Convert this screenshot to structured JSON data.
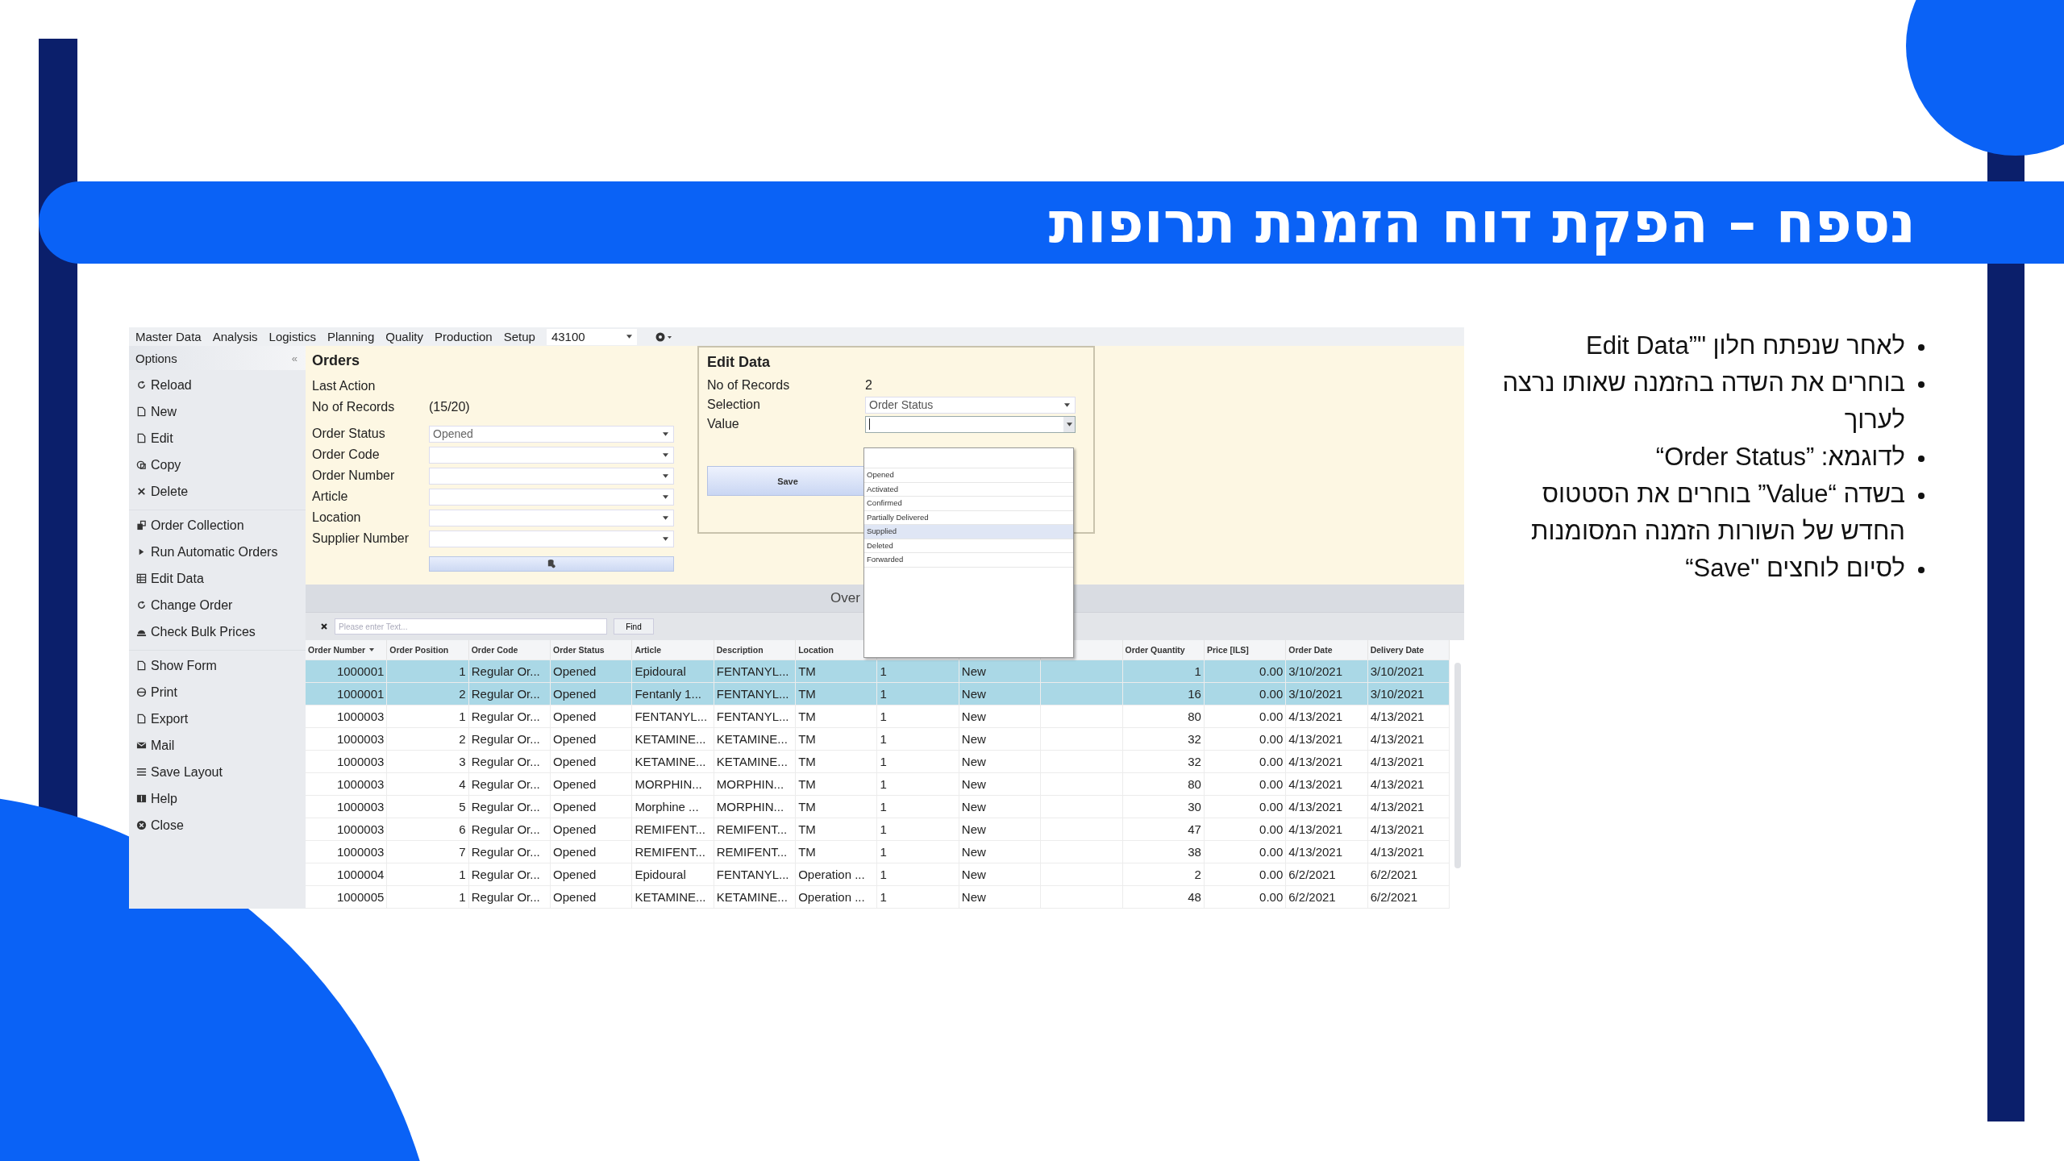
{
  "slide": {
    "title": "נספח – הפקת דוח הזמנת תרופות",
    "bullets": [
      "לאחר שנפתח חלון \"”Edit Data",
      "בוחרים את השדה בהזמנה שאותו נרצה לערוך",
      "לדוגמא: ”Order Status“",
      "בשדה “Value” בוחרים את הסטטוס החדש של השורות הזמנה המסומנות",
      "לסיום לוחצים \"Save“"
    ]
  },
  "app": {
    "menu": [
      "Master Data",
      "Analysis",
      "Logistics",
      "Planning",
      "Quality",
      "Production",
      "Setup"
    ],
    "combo": {
      "value": "43100"
    },
    "sidebar": {
      "title": "Options",
      "collapse": "«",
      "groups": [
        [
          "Reload",
          "New",
          "Edit",
          "Copy",
          "Delete"
        ],
        [
          "Order Collection",
          "Run Automatic Orders",
          "Edit Data",
          "Change Order",
          "Check Bulk Prices"
        ],
        [
          "Show Form",
          "Print",
          "Export",
          "Mail",
          "Save Layout",
          "Help",
          "Close"
        ]
      ]
    },
    "form": {
      "title": "Orders",
      "last_action": {
        "label": "Last Action"
      },
      "records": {
        "label": "No of Records",
        "value": "(15/20)"
      },
      "filters": [
        {
          "label": "Order Status",
          "value": "Opened"
        },
        {
          "label": "Order Code"
        },
        {
          "label": "Order Number"
        },
        {
          "label": "Article"
        },
        {
          "label": "Location"
        },
        {
          "label": "Supplier Number"
        }
      ]
    },
    "edit_dialog": {
      "title": "Edit Data",
      "records": {
        "label": "No of Records",
        "value": "2"
      },
      "selection": {
        "label": "Selection",
        "value": "Order Status"
      },
      "value_field": {
        "label": "Value",
        "expanded": true
      },
      "save": "Save",
      "options": [
        {
          "label": "Opened",
          "selected": false
        },
        {
          "label": "Activated",
          "selected": false
        },
        {
          "label": "Confirmed",
          "selected": false
        },
        {
          "label": "Partially Delivered",
          "selected": false
        },
        {
          "label": "Supplied",
          "selected": true
        },
        {
          "label": "Deleted",
          "selected": false
        },
        {
          "label": "Forwarded",
          "selected": false
        }
      ]
    },
    "overview": {
      "title": "Over",
      "search": {
        "placeholder": "Please enter Text...",
        "button": "Find"
      }
    },
    "table": {
      "columns_left": [
        "Order Number",
        "Order Position",
        "Order Code",
        "Order Status",
        "Article",
        "Description",
        "Location"
      ],
      "columns_right": [
        "Order Quantity",
        "Price [ILS]",
        "Order Date",
        "Delivery Date"
      ],
      "rows": [
        {
          "selected": true,
          "cells": [
            "1000001",
            "1",
            "Regular Or...",
            "Opened",
            "Epidoural",
            "FENTANYL...",
            "TM",
            "1",
            "New",
            "1",
            "0.00",
            "3/10/2021",
            "3/10/2021"
          ]
        },
        {
          "selected": true,
          "cells": [
            "1000001",
            "2",
            "Regular Or...",
            "Opened",
            "Fentanly 1...",
            "FENTANYL...",
            "TM",
            "1",
            "New",
            "16",
            "0.00",
            "3/10/2021",
            "3/10/2021"
          ]
        },
        {
          "selected": false,
          "cells": [
            "1000003",
            "1",
            "Regular Or...",
            "Opened",
            "FENTANYL...",
            "FENTANYL...",
            "TM",
            "1",
            "New",
            "80",
            "0.00",
            "4/13/2021",
            "4/13/2021"
          ]
        },
        {
          "selected": false,
          "cells": [
            "1000003",
            "2",
            "Regular Or...",
            "Opened",
            "KETAMINE...",
            "KETAMINE...",
            "TM",
            "1",
            "New",
            "32",
            "0.00",
            "4/13/2021",
            "4/13/2021"
          ]
        },
        {
          "selected": false,
          "cells": [
            "1000003",
            "3",
            "Regular Or...",
            "Opened",
            "KETAMINE...",
            "KETAMINE...",
            "TM",
            "1",
            "New",
            "32",
            "0.00",
            "4/13/2021",
            "4/13/2021"
          ]
        },
        {
          "selected": false,
          "cells": [
            "1000003",
            "4",
            "Regular Or...",
            "Opened",
            "MORPHIN...",
            "MORPHIN...",
            "TM",
            "1",
            "New",
            "80",
            "0.00",
            "4/13/2021",
            "4/13/2021"
          ]
        },
        {
          "selected": false,
          "cells": [
            "1000003",
            "5",
            "Regular Or...",
            "Opened",
            "Morphine ...",
            "MORPHIN...",
            "TM",
            "1",
            "New",
            "30",
            "0.00",
            "4/13/2021",
            "4/13/2021"
          ]
        },
        {
          "selected": false,
          "cells": [
            "1000003",
            "6",
            "Regular Or...",
            "Opened",
            "REMIFENT...",
            "REMIFENT...",
            "TM",
            "1",
            "New",
            "47",
            "0.00",
            "4/13/2021",
            "4/13/2021"
          ]
        },
        {
          "selected": false,
          "cells": [
            "1000003",
            "7",
            "Regular Or...",
            "Opened",
            "REMIFENT...",
            "REMIFENT...",
            "TM",
            "1",
            "New",
            "38",
            "0.00",
            "4/13/2021",
            "4/13/2021"
          ]
        },
        {
          "selected": false,
          "cells": [
            "1000004",
            "1",
            "Regular Or...",
            "Opened",
            "Epidoural",
            "FENTANYL...",
            "Operation ...",
            "1",
            "New",
            "2",
            "0.00",
            "6/2/2021",
            "6/2/2021"
          ]
        },
        {
          "selected": false,
          "cells": [
            "1000005",
            "1",
            "Regular Or...",
            "Opened",
            "KETAMINE...",
            "KETAMINE...",
            "Operation ...",
            "1",
            "New",
            "48",
            "0.00",
            "6/2/2021",
            "6/2/2021"
          ]
        }
      ]
    }
  }
}
